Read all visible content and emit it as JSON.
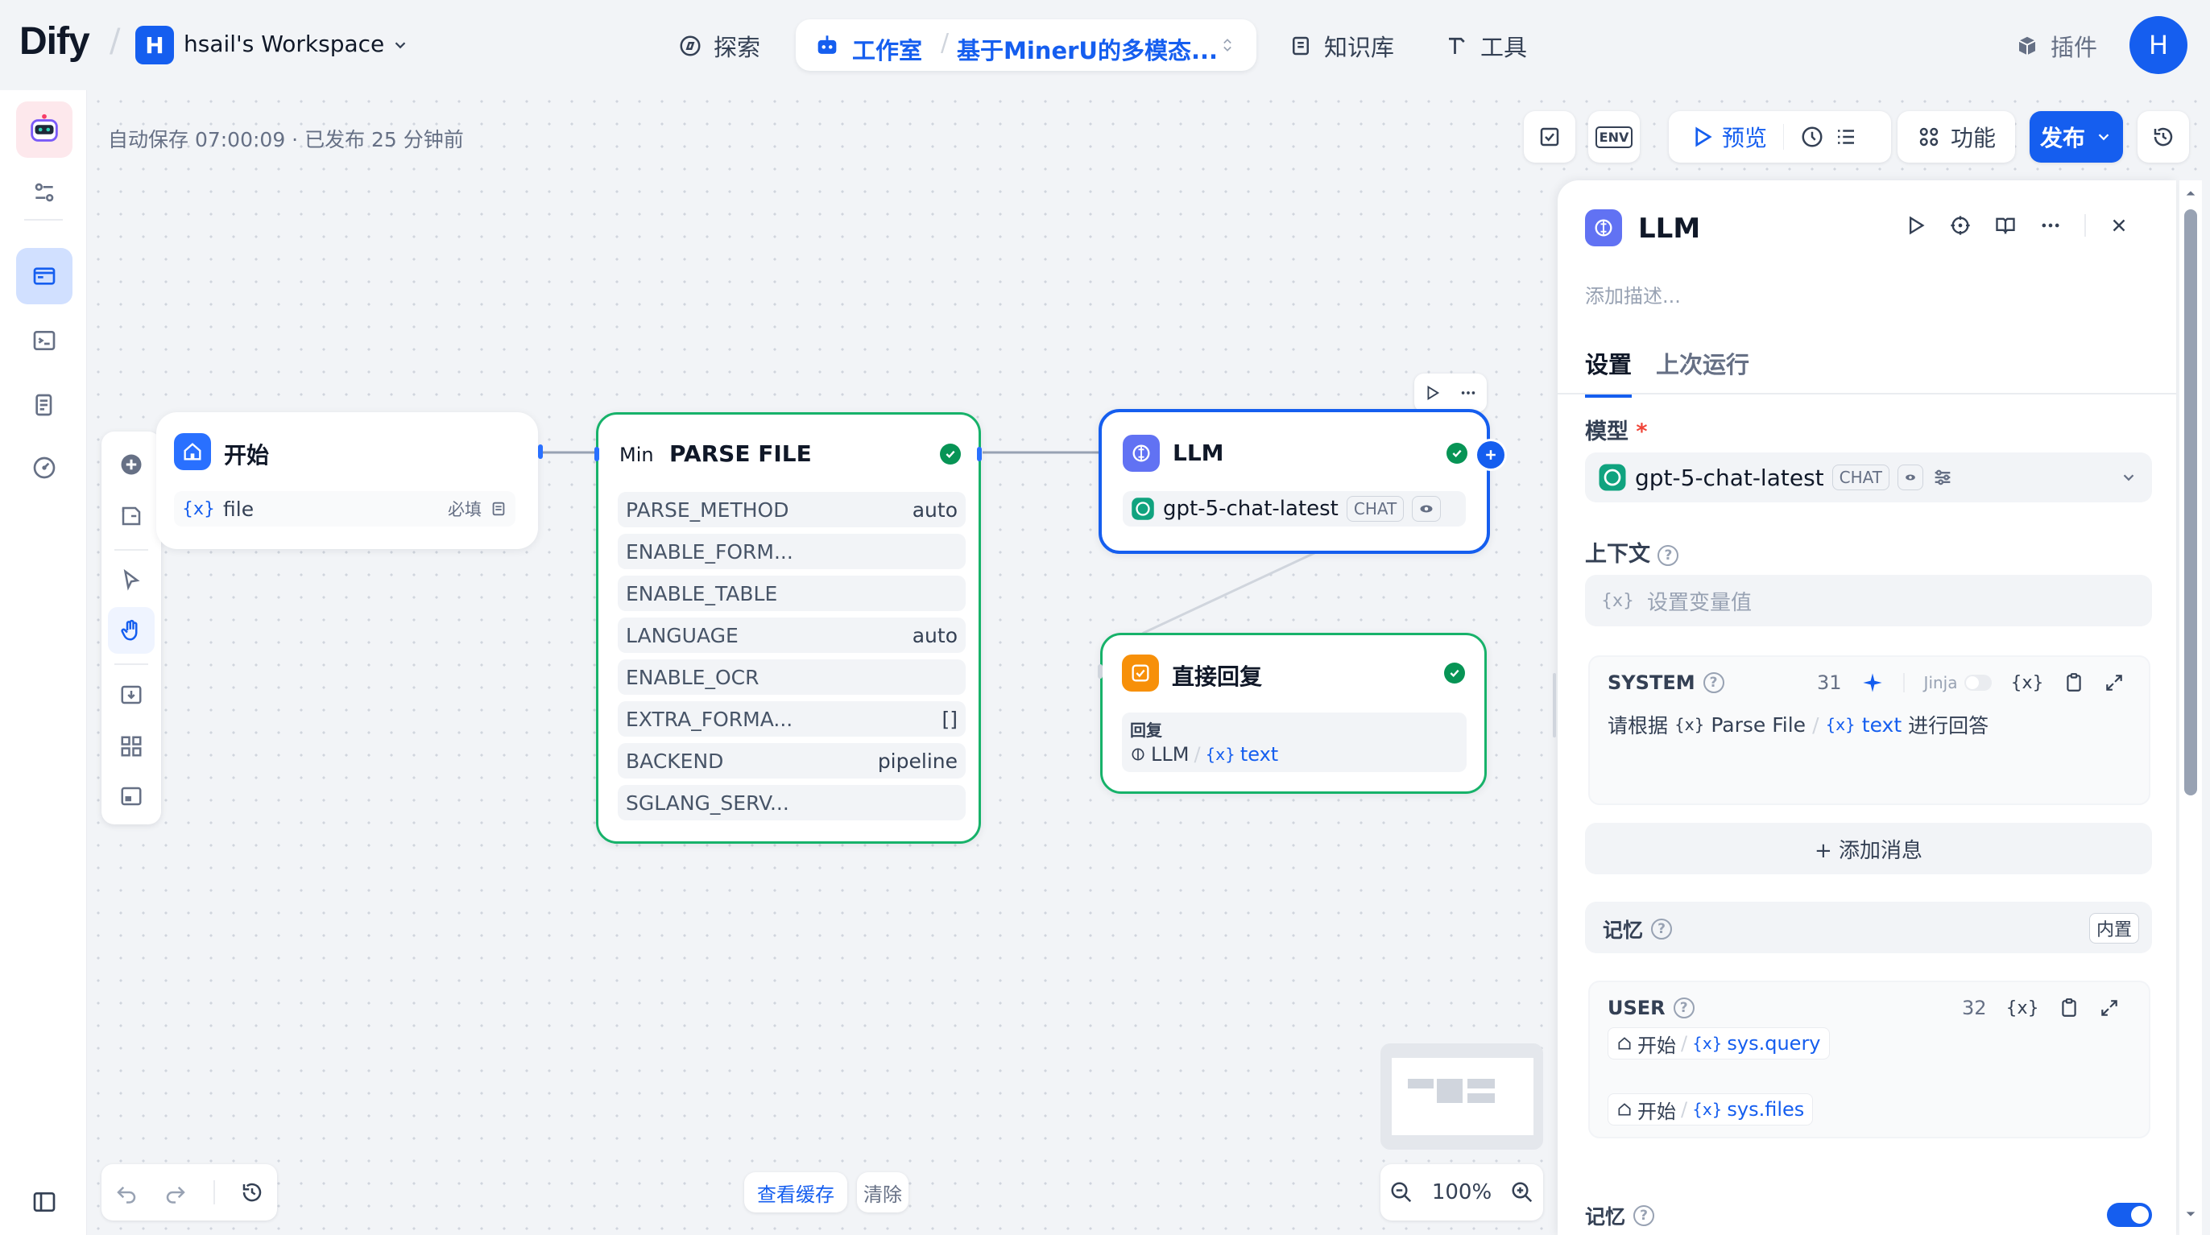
{
  "header": {
    "logo_text": "Dify",
    "workspace_initial": "H",
    "workspace_name": "hsail's Workspace",
    "nav": {
      "explore": "探索",
      "studio": "工作室",
      "app_name": "基于MinerU的多模态...",
      "knowledge": "知识库",
      "tools": "工具"
    },
    "plugins": "插件",
    "user_initial": "H"
  },
  "toolbar": {
    "autosave": "自动保存 07:00:09 · 已发布 25 分钟前",
    "env": "ENV",
    "preview": "预览",
    "features": "功能",
    "publish": "发布"
  },
  "nodes": {
    "start": {
      "title": "开始",
      "var_name": "file",
      "required": "必填"
    },
    "parse_file": {
      "prefix": "Min",
      "title": "PARSE FILE",
      "params": [
        {
          "name": "PARSE_METHOD",
          "value": "auto"
        },
        {
          "name": "ENABLE_FORM...",
          "value": ""
        },
        {
          "name": "ENABLE_TABLE",
          "value": ""
        },
        {
          "name": "LANGUAGE",
          "value": "auto"
        },
        {
          "name": "ENABLE_OCR",
          "value": ""
        },
        {
          "name": "EXTRA_FORMA...",
          "value": "[]"
        },
        {
          "name": "BACKEND",
          "value": "pipeline"
        },
        {
          "name": "SGLANG_SERV...",
          "value": ""
        }
      ]
    },
    "llm": {
      "title": "LLM",
      "model": "gpt-5-chat-latest",
      "model_badge": "CHAT"
    },
    "reply": {
      "title": "直接回复",
      "reply_label": "回复",
      "source_node": "LLM",
      "source_var": "text"
    }
  },
  "panel": {
    "title": "LLM",
    "description_placeholder": "添加描述...",
    "tabs": [
      "设置",
      "上次运行"
    ],
    "model_label": "模型",
    "required_mark": "*",
    "model_name": "gpt-5-chat-latest",
    "model_badge": "CHAT",
    "context_label": "上下文",
    "context_placeholder": "设置变量值",
    "system": {
      "label": "SYSTEM",
      "count": "31",
      "jinja": "Jinja",
      "text_before": "请根据",
      "var1_node": "Parse File",
      "var1_name": "text",
      "text_after": "进行回答"
    },
    "add_message": "+ 添加消息",
    "memory_label": "记忆",
    "memory_badge": "内置",
    "user": {
      "label": "USER",
      "count": "32",
      "var1_node": "开始",
      "var1_name": "sys.query",
      "var2_node": "开始",
      "var2_name": "sys.files"
    },
    "memory2_label": "记忆"
  },
  "bottom": {
    "view_cache": "查看缓存",
    "clear": "清除",
    "zoom": "100%"
  },
  "colors": {
    "accent": "#155eef",
    "success": "#079455",
    "start_icon": "#2970ff",
    "llm_icon": "#6172f3",
    "reply_icon": "#f79009"
  }
}
